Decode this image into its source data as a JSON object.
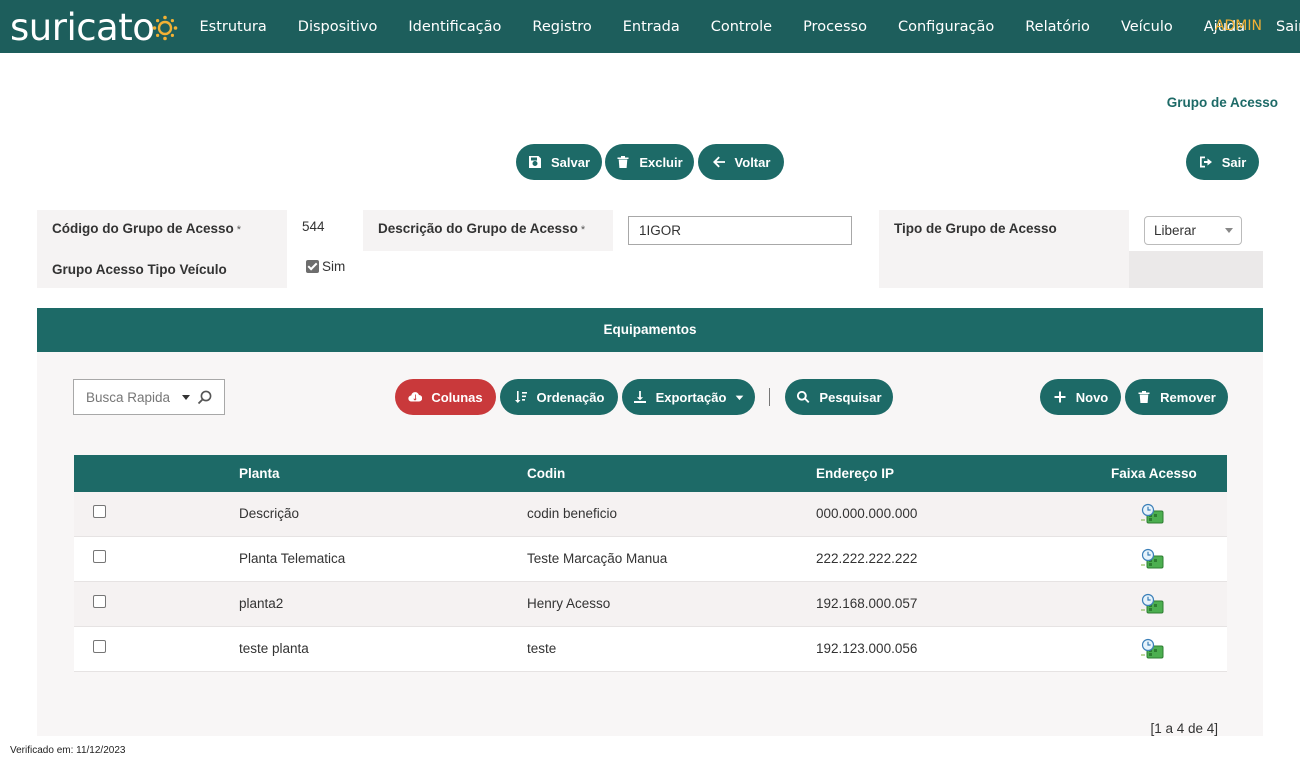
{
  "app": {
    "logo_text": "suricato",
    "admin_label": "ADMIN"
  },
  "nav": {
    "items": [
      "Estrutura",
      "Dispositivo",
      "Identificação",
      "Registro",
      "Entrada",
      "Controle",
      "Processo",
      "Configuração",
      "Relatório",
      "Veículo",
      "Ajuda",
      "Sair"
    ]
  },
  "page": {
    "title": "Grupo de Acesso"
  },
  "toolbar": {
    "save_label": "Salvar",
    "delete_label": "Excluir",
    "back_label": "Voltar",
    "exit_label": "Sair"
  },
  "form": {
    "codigo_label": "Código do Grupo de Acesso",
    "codigo_value": "544",
    "descricao_label": "Descrição do Grupo de Acesso",
    "descricao_value": "1IGOR",
    "tipo_label": "Tipo de Grupo de Acesso",
    "tipo_value": "Liberar",
    "veiculo_label": "Grupo Acesso Tipo Veículo",
    "veiculo_checked": true,
    "veiculo_option": "Sim",
    "required_mark": "*"
  },
  "equipamentos": {
    "title": "Equipamentos",
    "search_placeholder": "Busca Rapida",
    "buttons": {
      "colunas": "Colunas",
      "ordenacao": "Ordenação",
      "exportacao": "Exportação",
      "pesquisar": "Pesquisar",
      "novo": "Novo",
      "remover": "Remover"
    },
    "columns": [
      "Planta",
      "Codin",
      "Endereço IP",
      "Faixa Acesso"
    ],
    "rows": [
      {
        "planta": "Descrição",
        "codin": "codin beneficio",
        "ip": "000.000.000.000"
      },
      {
        "planta": "Planta Telematica",
        "codin": "Teste Marcação Manua",
        "ip": "222.222.222.222"
      },
      {
        "planta": "planta2",
        "codin": "Henry Acesso",
        "ip": "192.168.000.057"
      },
      {
        "planta": "teste planta",
        "codin": "teste",
        "ip": "192.123.000.056"
      }
    ],
    "pagination": "[1 a 4 de 4]"
  },
  "footer": {
    "verified": "Verificado em: 11/12/2023"
  },
  "colors": {
    "primary": "#1d6a67",
    "navbar": "#1d5e5c",
    "danger": "#c9393b",
    "admin": "#f2b134"
  }
}
